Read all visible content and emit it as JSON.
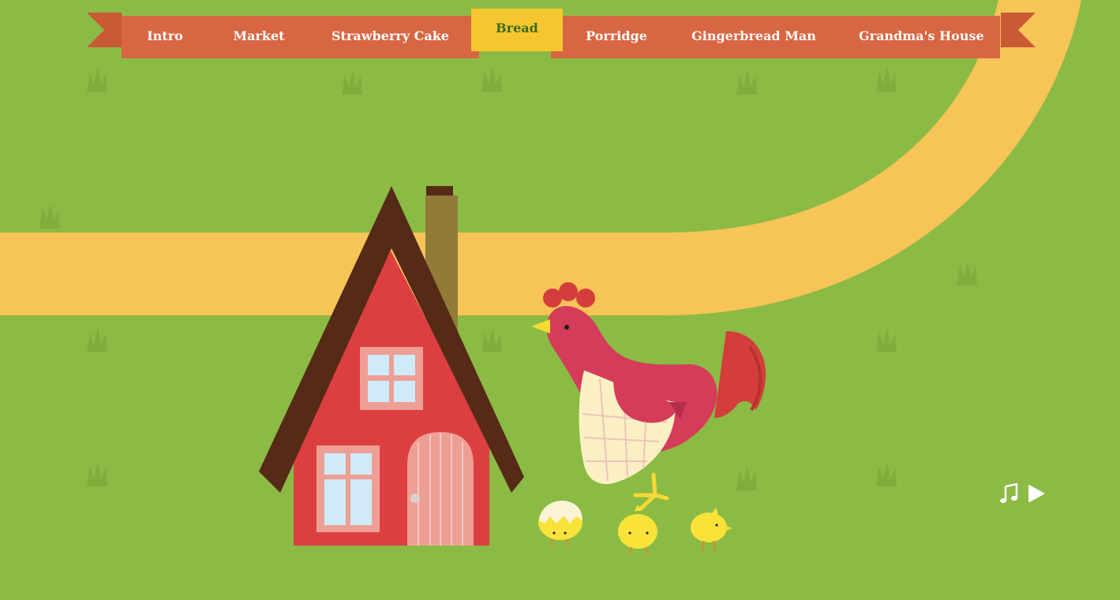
{
  "nav": {
    "items": [
      {
        "label": "Intro"
      },
      {
        "label": "Market"
      },
      {
        "label": "Strawberry Cake"
      },
      {
        "label": "Bread",
        "active": true
      },
      {
        "label": "Porridge"
      },
      {
        "label": "Gingerbread Man"
      },
      {
        "label": "Grandma's House"
      }
    ]
  },
  "controls": {
    "music_icon": "music-note-icon",
    "play_icon": "play-icon"
  },
  "colors": {
    "grass": "#8bbb44",
    "path": "#f7c457",
    "ribbon": "#d96642",
    "active_tab": "#f5c62f",
    "active_text": "#3c6a1a",
    "house_wall": "#dc3f3f",
    "roof": "#552a16",
    "hen": "#d43c5a",
    "chick": "#f9e338"
  }
}
